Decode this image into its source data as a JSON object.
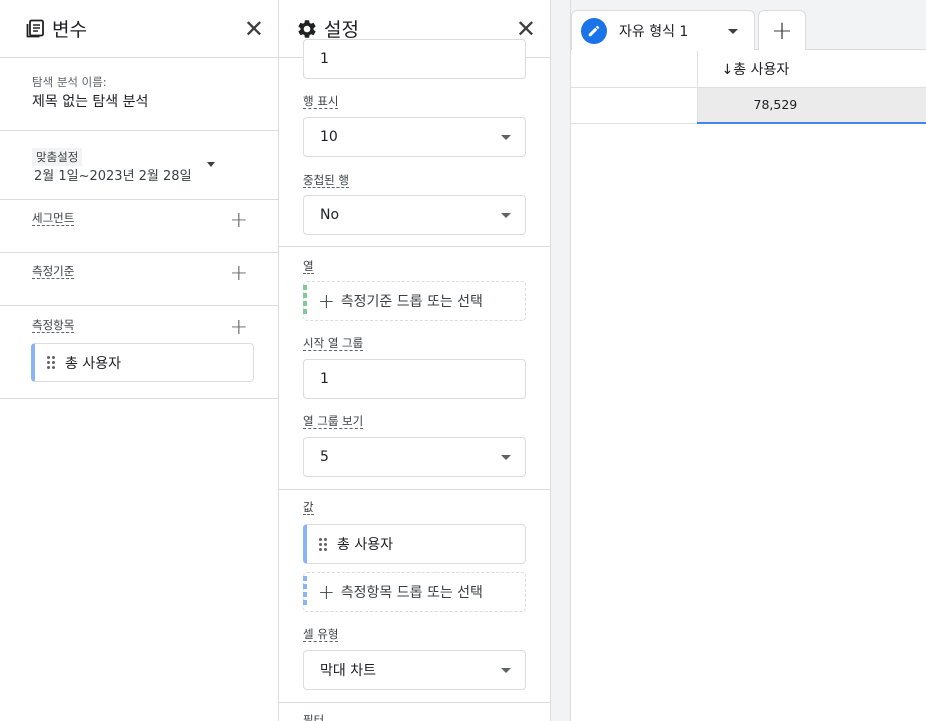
{
  "variables_panel": {
    "title": "변수",
    "exploration_name_label": "탐색 분석 이름:",
    "exploration_name": "제목 없는 탐색 분석",
    "date_custom_label": "맞춤설정",
    "date_range": "2월 1일~2023년 2월 28일",
    "segments_label": "세그먼트",
    "dimensions_label": "측정기준",
    "metrics_label": "측정항목",
    "metric_items": [
      "총 사용자"
    ]
  },
  "settings_panel": {
    "title": "설정",
    "partial_top_value": "1",
    "show_rows_label": "행 표시",
    "show_rows_value": "10",
    "nested_rows_label": "중첩된 행",
    "nested_rows_value": "No",
    "columns_label": "열",
    "columns_drop_text": "측정기준 드롭 또는 선택",
    "start_col_group_label": "시작 열 그룹",
    "start_col_group_value": "1",
    "show_col_groups_label": "열 그룹 보기",
    "show_col_groups_value": "5",
    "values_label": "값",
    "values_item": "총 사용자",
    "values_drop_text": "측정항목 드롭 또는 선택",
    "cell_type_label": "셀 유형",
    "cell_type_value": "막대 차트",
    "filters_label_partial": "필터"
  },
  "canvas": {
    "tab_name": "자유 형식 1",
    "add_tab_label": "+",
    "table": {
      "metric_header": "총 사용자",
      "sort_indicator": "↓",
      "metric_value": "78,529"
    }
  },
  "colors": {
    "accent": "#1a73e8",
    "dimension_stripe": "#81c995",
    "metric_stripe": "#8ab4f8",
    "bar_cell_bg": "#ebebeb",
    "bar_underline": "#4285f4"
  }
}
